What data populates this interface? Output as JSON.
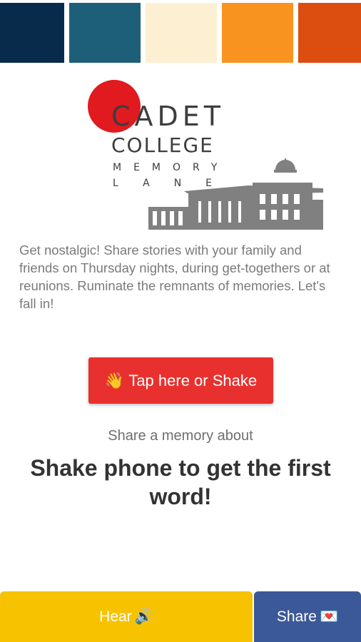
{
  "palette": [
    "#082b4b",
    "#1d5f78",
    "#fdefd1",
    "#f7931e",
    "#dc4d10"
  ],
  "logo": {
    "line1": "CADET",
    "line2": "COLLEGE",
    "line3": "MEMORY",
    "line4": "LANE",
    "accent_color": "#e01a1f"
  },
  "description": "Get nostalgic! Share stories with your family and friends on Thursday nights, during get-togethers or at reunions. Ruminate the remnants of memories. Let's fall in!",
  "tap_button": {
    "icon": "👋",
    "label": "Tap here or Shake",
    "color": "#e8312e"
  },
  "share_about": "Share a memory about",
  "prompt_word": "Shake phone to get the first word!",
  "bottom_bar": {
    "hear_label": "Hear",
    "hear_icon": "🔊",
    "hear_color": "#f7c200",
    "share_label": "Share",
    "share_icon": "💌",
    "share_color": "#3b5998"
  }
}
